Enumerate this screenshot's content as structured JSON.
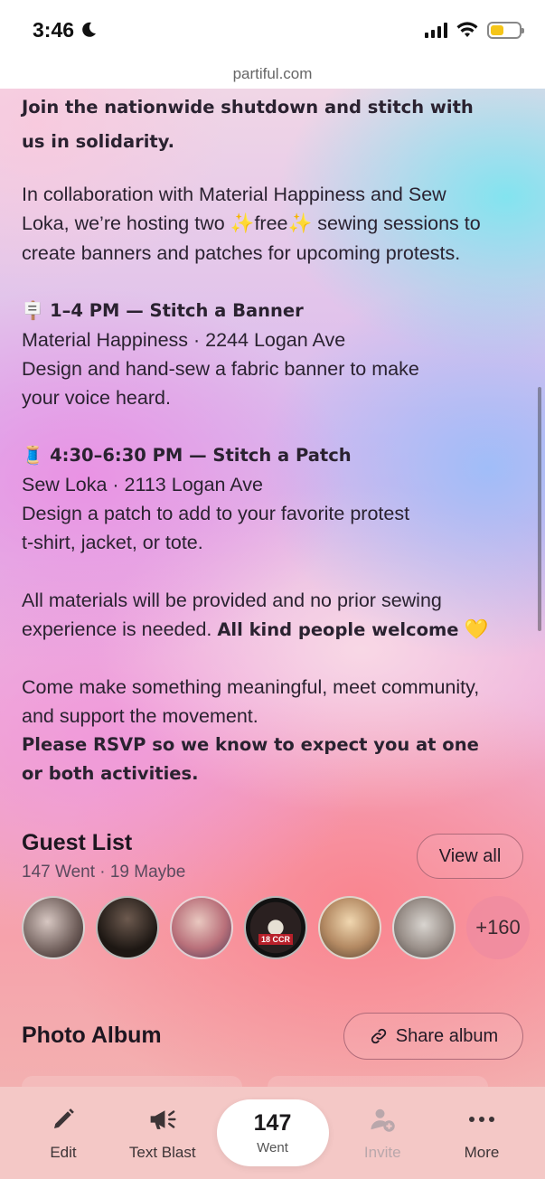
{
  "status_bar": {
    "time": "3:46",
    "battery_level": 0.45,
    "battery_color": "#f5c518"
  },
  "browser": {
    "url": "partiful.com"
  },
  "description": {
    "intro_bold_line1": "Join the nationwide shutdown and stitch with",
    "intro_bold_line2": "us in solidarity.",
    "collab_line1": "In collaboration with Material Happiness and Sew",
    "collab_line2_a": "Loka, we’re hosting two ",
    "sparkle": "✨",
    "collab_line2_free": "free",
    "collab_line2_b": " sewing sessions to",
    "collab_line3": "create banners and patches for upcoming protests.",
    "session1_emoji": "🪧",
    "session1_title": "1–4 PM — Stitch a Banner",
    "session1_location": "Material Happiness · 2244 Logan Ave",
    "session1_desc1": "Design and hand-sew a fabric banner to make",
    "session1_desc2": "your voice heard.",
    "session2_emoji": "🧵",
    "session2_title": "4:30–6:30 PM — Stitch a Patch",
    "session2_location": "Sew Loka · 2113 Logan Ave",
    "session2_desc1": "Design a patch to add to your favorite protest",
    "session2_desc2": "t-shirt, jacket, or tote.",
    "materials_line1": "All materials will be provided and no prior sewing",
    "materials_line2_a": "experience is needed. ",
    "materials_line2_bold": "All kind people welcome",
    "heart": "💛",
    "closing_line1": "Come make something meaningful, meet community,",
    "closing_line2": "and support the movement.",
    "rsvp_line1": "Please RSVP so we know to expect you at one",
    "rsvp_line2": "or both activities."
  },
  "guest_list": {
    "title": "Guest List",
    "counts": "147 Went · 19 Maybe",
    "view_all_label": "View all",
    "avatar_badge_text": "18 CCR",
    "more_count": "+160"
  },
  "photo_album": {
    "title": "Photo Album",
    "share_label": "Share album"
  },
  "toolbar": {
    "edit_label": "Edit",
    "text_blast_label": "Text Blast",
    "went_count": "147",
    "went_label": "Went",
    "invite_label": "Invite",
    "more_label": "More"
  }
}
